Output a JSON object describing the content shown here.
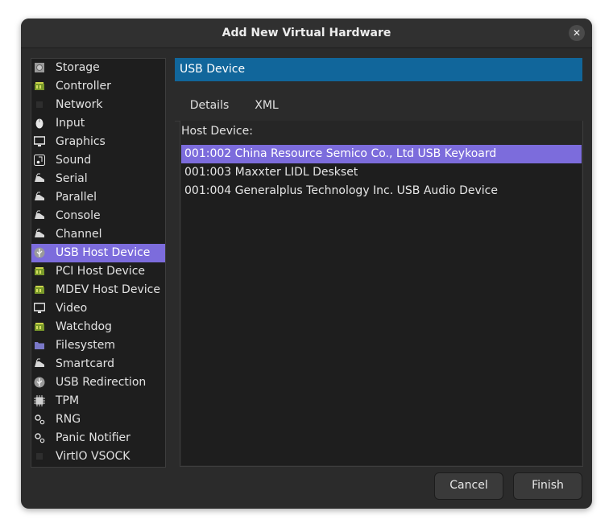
{
  "dialog": {
    "title": "Add New Virtual Hardware",
    "close_glyph": "✕"
  },
  "sidebar": {
    "items": [
      {
        "label": "Storage",
        "icon": "storage-icon"
      },
      {
        "label": "Controller",
        "icon": "controller-icon"
      },
      {
        "label": "Network",
        "icon": "network-icon"
      },
      {
        "label": "Input",
        "icon": "mouse-icon"
      },
      {
        "label": "Graphics",
        "icon": "monitor-icon"
      },
      {
        "label": "Sound",
        "icon": "sound-icon"
      },
      {
        "label": "Serial",
        "icon": "serial-icon"
      },
      {
        "label": "Parallel",
        "icon": "parallel-icon"
      },
      {
        "label": "Console",
        "icon": "console-icon"
      },
      {
        "label": "Channel",
        "icon": "channel-icon"
      },
      {
        "label": "USB Host Device",
        "icon": "usb-icon",
        "selected": true
      },
      {
        "label": "PCI Host Device",
        "icon": "pci-icon"
      },
      {
        "label": "MDEV Host Device",
        "icon": "mdev-icon"
      },
      {
        "label": "Video",
        "icon": "video-icon"
      },
      {
        "label": "Watchdog",
        "icon": "watchdog-icon"
      },
      {
        "label": "Filesystem",
        "icon": "folder-icon"
      },
      {
        "label": "Smartcard",
        "icon": "smartcard-icon"
      },
      {
        "label": "USB Redirection",
        "icon": "usb-redirection-icon"
      },
      {
        "label": "TPM",
        "icon": "chip-icon"
      },
      {
        "label": "RNG",
        "icon": "rng-icon"
      },
      {
        "label": "Panic Notifier",
        "icon": "panic-icon"
      },
      {
        "label": "VirtIO VSOCK",
        "icon": "vsock-icon"
      }
    ]
  },
  "main": {
    "header": "USB Device",
    "tabs": [
      {
        "label": "Details",
        "active": true
      },
      {
        "label": "XML",
        "active": false
      }
    ],
    "host_device_label": "Host Device:",
    "devices": [
      {
        "text": "001:002 China Resource Semico Co., Ltd USB Keykoard",
        "selected": true
      },
      {
        "text": "001:003 Maxxter LIDL Deskset",
        "selected": false
      },
      {
        "text": "001:004 Generalplus Technology Inc. USB Audio Device",
        "selected": false
      }
    ]
  },
  "buttons": {
    "cancel": "Cancel",
    "finish": "Finish"
  },
  "colors": {
    "accent": "#7c6cdc",
    "header": "#11669b",
    "background": "#2b2b2b"
  }
}
